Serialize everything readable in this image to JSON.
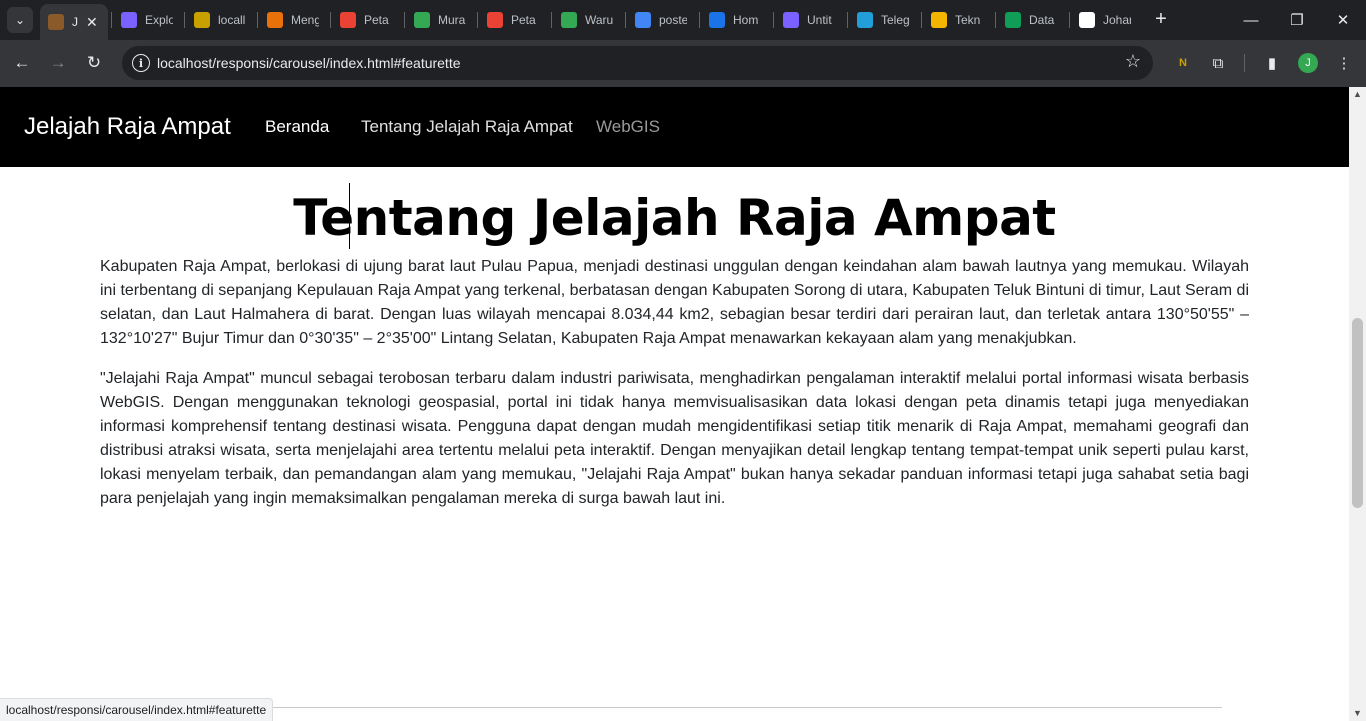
{
  "browser": {
    "tabs": [
      {
        "title": "J",
        "active": true,
        "favicon_color": "#8b5a2b"
      },
      {
        "title": "Explo",
        "active": false,
        "favicon_color": "#7b61ff"
      },
      {
        "title": "locall",
        "active": false,
        "favicon_color": "#c8a000"
      },
      {
        "title": "Meng",
        "active": false,
        "favicon_color": "#e8710a"
      },
      {
        "title": "Peta",
        "active": false,
        "favicon_color": "#ea4335"
      },
      {
        "title": "Mura",
        "active": false,
        "favicon_color": "#34a853"
      },
      {
        "title": "Peta",
        "active": false,
        "favicon_color": "#ea4335"
      },
      {
        "title": "Waru",
        "active": false,
        "favicon_color": "#34a853"
      },
      {
        "title": "poste",
        "active": false,
        "favicon_color": "#4285f4"
      },
      {
        "title": "Hom",
        "active": false,
        "favicon_color": "#1a73e8"
      },
      {
        "title": "Untit",
        "active": false,
        "favicon_color": "#7b61ff"
      },
      {
        "title": "Teleg",
        "active": false,
        "favicon_color": "#229ed9"
      },
      {
        "title": "Tekn",
        "active": false,
        "favicon_color": "#f4b400"
      },
      {
        "title": "Data",
        "active": false,
        "favicon_color": "#0f9d58"
      },
      {
        "title": "Johar",
        "active": false,
        "favicon_color": "#ffffff"
      }
    ],
    "address": "localhost/responsi/carousel/index.html#featurette",
    "profile_initial": "J",
    "status_url": "localhost/responsi/carousel/index.html#featurette"
  },
  "page": {
    "navbar": {
      "brand": "Jelajah Raja Ampat",
      "links": [
        {
          "label": "Beranda",
          "color": "#ffffff"
        },
        {
          "label": "Tentang Jelajah Raja Ampat",
          "color": "#e0e0e0"
        },
        {
          "label": "WebGIS",
          "color": "#9a9a9a"
        }
      ]
    },
    "heading": "Tentang Jelajah Raja Ampat",
    "paragraphs": [
      "Kabupaten Raja Ampat, berlokasi di ujung barat laut Pulau Papua, menjadi destinasi unggulan dengan keindahan alam bawah lautnya yang memukau. Wilayah ini terbentang di sepanjang Kepulauan Raja Ampat yang terkenal, berbatasan dengan Kabupaten Sorong di utara, Kabupaten Teluk Bintuni di timur, Laut Seram di selatan, dan Laut Halmahera di barat. Dengan luas wilayah mencapai 8.034,44 km2, sebagian besar terdiri dari perairan laut, dan terletak antara 130°50'55\" – 132°10'27\" Bujur Timur dan 0°30'35\" – 2°35'00\" Lintang Selatan, Kabupaten Raja Ampat menawarkan kekayaan alam yang menakjubkan.",
      "\"Jelajahi Raja Ampat\" muncul sebagai terobosan terbaru dalam industri pariwisata, menghadirkan pengalaman interaktif melalui portal informasi wisata berbasis WebGIS. Dengan menggunakan teknologi geospasial, portal ini tidak hanya memvisualisasikan data lokasi dengan peta dinamis tetapi juga menyediakan informasi komprehensif tentang destinasi wisata. Pengguna dapat dengan mudah mengidentifikasi setiap titik menarik di Raja Ampat, memahami geografi dan distribusi atraksi wisata, serta menjelajahi area tertentu melalui peta interaktif. Dengan menyajikan detail lengkap tentang tempat-tempat unik seperti pulau karst, lokasi menyelam terbaik, dan pemandangan alam yang memukau, \"Jelajahi Raja Ampat\" bukan hanya sekadar panduan informasi tetapi juga sahabat setia bagi para penjelajah yang ingin memaksimalkan pengalaman mereka di surga bawah laut ini."
    ],
    "scroll_position_fraction": 0.35
  }
}
